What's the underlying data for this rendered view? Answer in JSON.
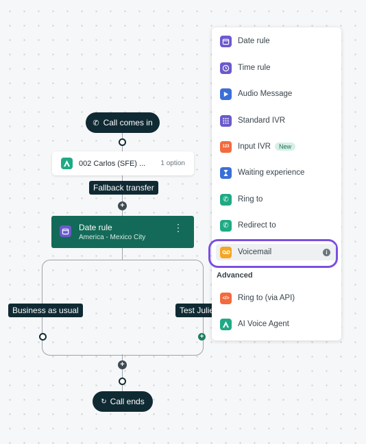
{
  "flow": {
    "start_label": "Call comes in",
    "ivr_node": {
      "name": "002 Carlos (SFE) ...",
      "count": "1 option"
    },
    "fallback_label": "Fallback transfer",
    "date_rule_node": {
      "title": "Date rule",
      "subtitle": "America - Mexico City"
    },
    "branch_left": "Business as usual",
    "branch_right": "Test Juliet",
    "end_label": "Call ends"
  },
  "menu": {
    "items": [
      {
        "label": "Date rule",
        "icon": "calendar-icon",
        "color": "#6a5acd"
      },
      {
        "label": "Time rule",
        "icon": "clock-icon",
        "color": "#6a5acd"
      },
      {
        "label": "Audio Message",
        "icon": "play-icon",
        "color": "#3b6fd8"
      },
      {
        "label": "Standard IVR",
        "icon": "grid-icon",
        "color": "#6a5acd"
      },
      {
        "label": "Input IVR",
        "icon": "keypad-icon",
        "color": "#f26a3d",
        "badge": "New"
      },
      {
        "label": "Waiting experience",
        "icon": "hourglass-icon",
        "color": "#3b6fd8"
      },
      {
        "label": "Ring to",
        "icon": "phone-ring-icon",
        "color": "#1faa84"
      },
      {
        "label": "Redirect to",
        "icon": "phone-redirect-icon",
        "color": "#1faa84"
      },
      {
        "label": "Voicemail",
        "icon": "voicemail-icon",
        "color": "#f5a623"
      }
    ],
    "section_label": "Advanced",
    "advanced_items": [
      {
        "label": "Ring to (via API)",
        "icon": "code-icon",
        "color": "#f26a3d"
      },
      {
        "label": "AI Voice Agent",
        "icon": "ai-agent-icon",
        "color": "#1faa84"
      }
    ],
    "highlight_color": "#7b4fe0"
  }
}
